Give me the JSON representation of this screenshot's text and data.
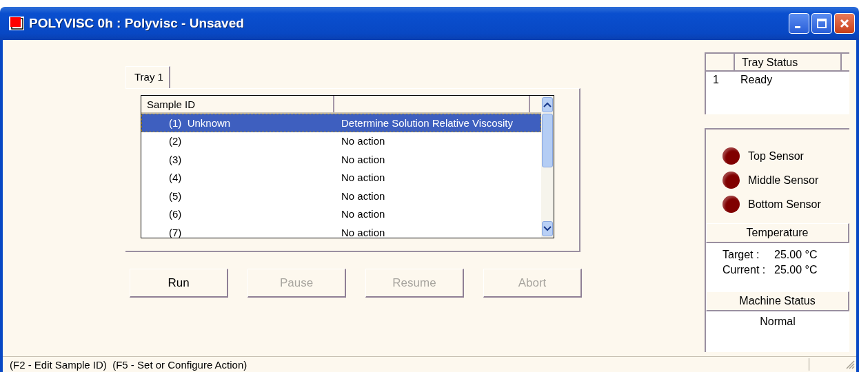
{
  "window": {
    "title": "POLYVISC 0h : Polyvisc - Unsaved"
  },
  "tabs": [
    {
      "label": "Tray 1",
      "selected": true
    }
  ],
  "sample_table": {
    "columns": [
      "Sample ID"
    ],
    "rows": [
      {
        "sample": "(1)  Unknown",
        "action": "Determine Solution Relative Viscosity",
        "selected": true
      },
      {
        "sample": "(2)",
        "action": "No action",
        "selected": false
      },
      {
        "sample": "(3)",
        "action": "No action",
        "selected": false
      },
      {
        "sample": "(4)",
        "action": "No action",
        "selected": false
      },
      {
        "sample": "(5)",
        "action": "No action",
        "selected": false
      },
      {
        "sample": "(6)",
        "action": "No action",
        "selected": false
      },
      {
        "sample": "(7)",
        "action": "No action",
        "selected": false
      }
    ]
  },
  "buttons": [
    {
      "label": "Run",
      "disabled": false
    },
    {
      "label": "Pause",
      "disabled": true
    },
    {
      "label": "Resume",
      "disabled": true
    },
    {
      "label": "Abort",
      "disabled": true
    }
  ],
  "tray_status": {
    "column": "Tray Status",
    "rows": [
      {
        "number": "1",
        "status": "Ready"
      }
    ]
  },
  "sensors": [
    {
      "label": "Top Sensor",
      "color": "#800000"
    },
    {
      "label": "Middle Sensor",
      "color": "#800000"
    },
    {
      "label": "Bottom Sensor",
      "color": "#800000"
    }
  ],
  "temperature": {
    "heading": "Temperature",
    "target_label": "Target :",
    "target": "25.00 °C",
    "current_label": "Current :",
    "current": "25.00 °C"
  },
  "machine_status": {
    "heading": "Machine Status",
    "value": "Normal"
  },
  "status_bar": "(F2 - Edit Sample ID)  (F5 - Set or Configure Action)"
}
